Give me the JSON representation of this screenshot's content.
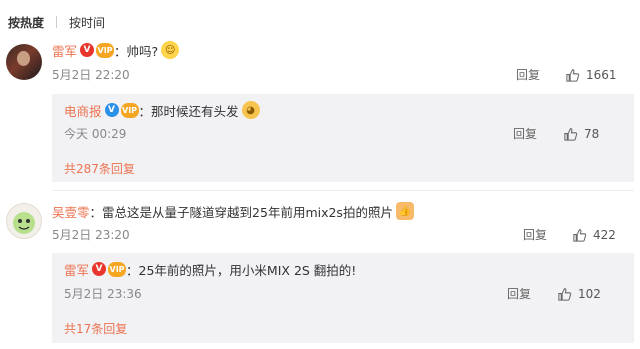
{
  "sort": {
    "hot": "按热度",
    "time": "按时间"
  },
  "comments": [
    {
      "user": "雷军",
      "text": "帅吗?",
      "time": "5月2日 22:20",
      "reply_label": "回复",
      "likes": "1661",
      "replies": [
        {
          "user": "电商报",
          "text": "那时候还有头发",
          "time": "今天 00:29",
          "reply_label": "回复",
          "likes": "78"
        }
      ],
      "total_replies": "共287条回复"
    },
    {
      "user": "吴壹零",
      "text": "雷总这是从量子隧道穿越到25年前用mix2s拍的照片",
      "time": "5月2日 23:20",
      "reply_label": "回复",
      "likes": "422",
      "replies": [
        {
          "user": "雷军",
          "text": "25年前的照片，用小米MIX 2S 翻拍的!",
          "time": "5月2日 23:36",
          "reply_label": "回复",
          "likes": "102"
        }
      ],
      "total_replies": "共17条回复"
    }
  ],
  "colors": {
    "username": "#eb7350",
    "subreply_bg": "#f2f2f5",
    "meta_text": "#888888"
  },
  "icons": {
    "like": "thumbs-up-icon",
    "verified": "v-badge-icon",
    "vip": "vip-badge-icon"
  }
}
